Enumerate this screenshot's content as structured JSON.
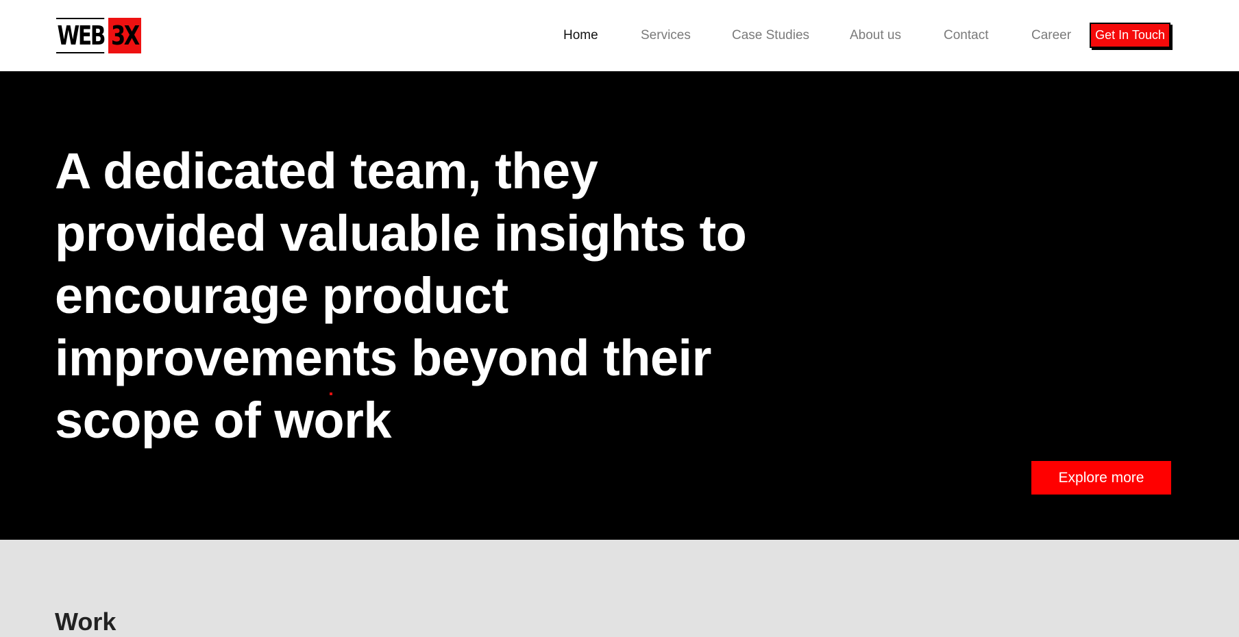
{
  "brand": {
    "logo_word": "WEB",
    "logo_mark": "3X",
    "accent_color": "#ff0000"
  },
  "nav": {
    "items": [
      {
        "label": "Home",
        "active": true
      },
      {
        "label": "Services",
        "active": false
      },
      {
        "label": "Case Studies",
        "active": false
      },
      {
        "label": "About us",
        "active": false
      },
      {
        "label": "Contact",
        "active": false
      },
      {
        "label": "Career",
        "active": false
      }
    ],
    "cta_label": "Get In Touch"
  },
  "hero": {
    "title": "A dedicated team, they provided valuable insights to encourage product improvements beyond their scope of work",
    "button_label": "Explore more"
  },
  "work": {
    "title": "Work"
  }
}
